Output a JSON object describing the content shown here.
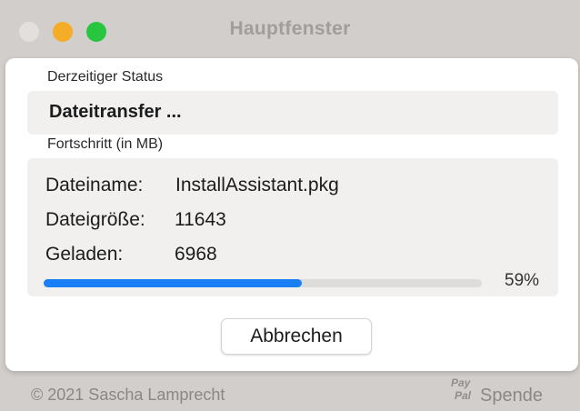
{
  "window": {
    "title": "Hauptfenster"
  },
  "status": {
    "label": "Derzeitiger Status",
    "value": "Dateitransfer ..."
  },
  "progress": {
    "label": "Fortschritt (in MB)",
    "filename_label": "Dateiname:",
    "filename_value": "InstallAssistant.pkg",
    "filesize_label": "Dateigröße:",
    "filesize_value": "11643",
    "loaded_label": "Geladen:",
    "loaded_value": "6968",
    "percent_text": "59%",
    "fraction": 0.59
  },
  "actions": {
    "cancel_label": "Abbrechen"
  },
  "footer": {
    "copyright": "© 2021 Sascha Lamprecht",
    "paypal_logo_line1": "Pay",
    "paypal_logo_line2": "Pal",
    "donate_label": "Spende"
  },
  "colors": {
    "accent": "#1a7ff5",
    "traffic_min": "#f5ad27",
    "traffic_max": "#28c63f"
  },
  "icons": {
    "donate": "paypal-icon"
  }
}
